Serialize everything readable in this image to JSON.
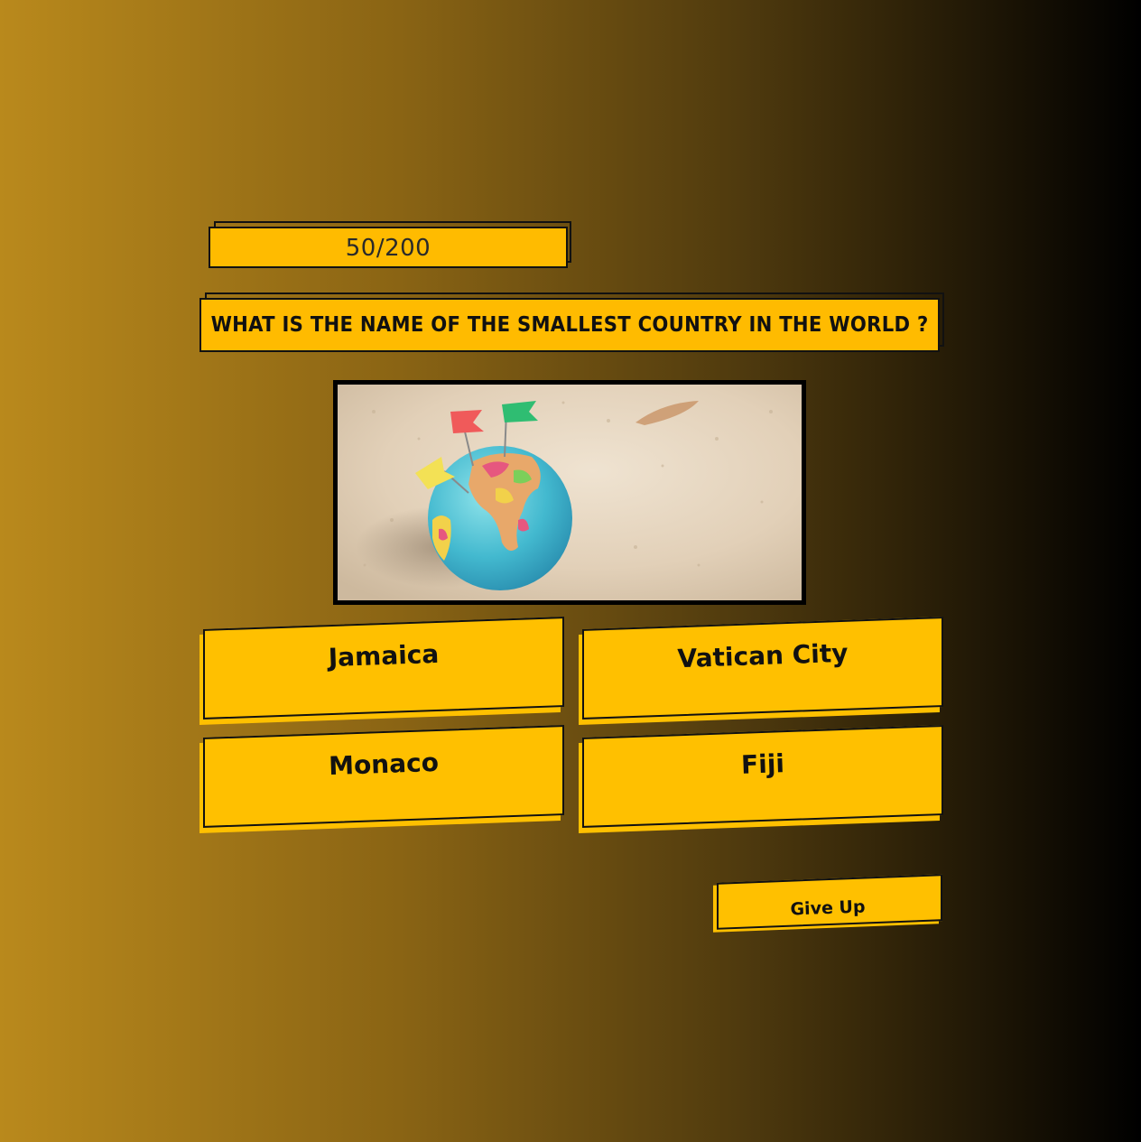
{
  "score": {
    "text": "50/200"
  },
  "question": {
    "text": "WHAT IS THE NAME OF THE SMALLEST COUNTRY IN THE WORLD ?"
  },
  "picture": {
    "subject": "globe-with-flags-on-sand"
  },
  "answers": [
    {
      "label": "Jamaica"
    },
    {
      "label": "Vatican City"
    },
    {
      "label": "Monaco"
    },
    {
      "label": "Fiji"
    }
  ],
  "controls": {
    "give_up_label": "Give Up"
  },
  "colors": {
    "accent": "#ffc000",
    "border": "#111111",
    "background_start": "#b9891c",
    "background_end": "#000000"
  }
}
